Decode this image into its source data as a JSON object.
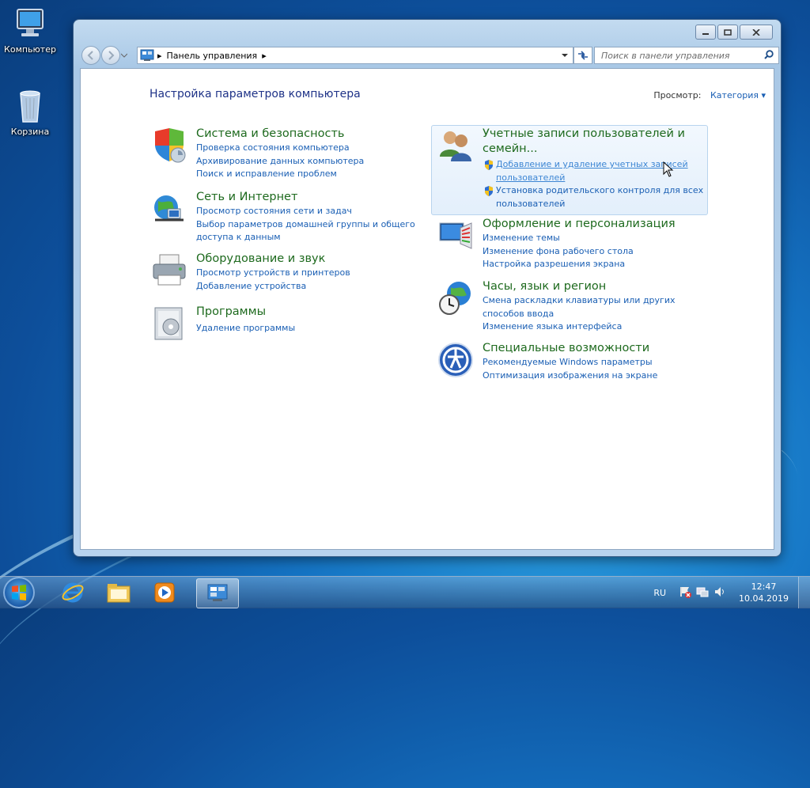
{
  "desktop": {
    "icons": [
      {
        "label": "Компьютер",
        "icon": "computer-icon"
      },
      {
        "label": "Корзина",
        "icon": "recycle-bin-icon"
      }
    ]
  },
  "window": {
    "address": {
      "breadcrumb": "Панель управления",
      "search_placeholder": "Поиск в панели управления"
    },
    "page_title": "Настройка параметров компьютера",
    "view_by": {
      "label": "Просмотр:",
      "value": "Категория"
    },
    "categories_left": [
      {
        "title": "Система и безопасность",
        "icon": "shield-icon",
        "links": [
          "Проверка состояния компьютера",
          "Архивирование данных компьютера",
          "Поиск и исправление проблем"
        ]
      },
      {
        "title": "Сеть и Интернет",
        "icon": "network-globe-icon",
        "links": [
          "Просмотр состояния сети и задач",
          "Выбор параметров домашней группы и общего",
          "доступа к данным"
        ]
      },
      {
        "title": "Оборудование и звук",
        "icon": "printer-icon",
        "links": [
          "Просмотр устройств и принтеров",
          "Добавление устройства"
        ]
      },
      {
        "title": "Программы",
        "icon": "programs-icon",
        "links": [
          "Удаление программы"
        ]
      }
    ],
    "categories_right": [
      {
        "title_line1": "Учетные записи пользователей и",
        "title_line2": "семейн...",
        "icon": "users-icon",
        "links": [
          "Добавление и удаление учетных записей",
          "пользователей",
          "Установка родительского контроля для всех",
          "пользователей"
        ]
      },
      {
        "title": "Оформление и персонализация",
        "icon": "appearance-icon",
        "links": [
          "Изменение темы",
          "Изменение фона рабочего стола",
          "Настройка разрешения экрана"
        ]
      },
      {
        "title": "Часы, язык и регион",
        "icon": "clock-globe-icon",
        "links": [
          "Смена раскладки клавиатуры или других",
          "способов ввода",
          "Изменение языка интерфейса"
        ]
      },
      {
        "title": "Специальные возможности",
        "icon": "accessibility-icon",
        "links": [
          "Рекомендуемые Windows параметры",
          "Оптимизация изображения на экране"
        ]
      }
    ]
  },
  "taskbar": {
    "lang": "RU",
    "time": "12:47",
    "date": "10.04.2019"
  },
  "colors": {
    "link": "#1a5fb4",
    "category_title": "#1e6a1e",
    "page_title": "#1e3287"
  }
}
